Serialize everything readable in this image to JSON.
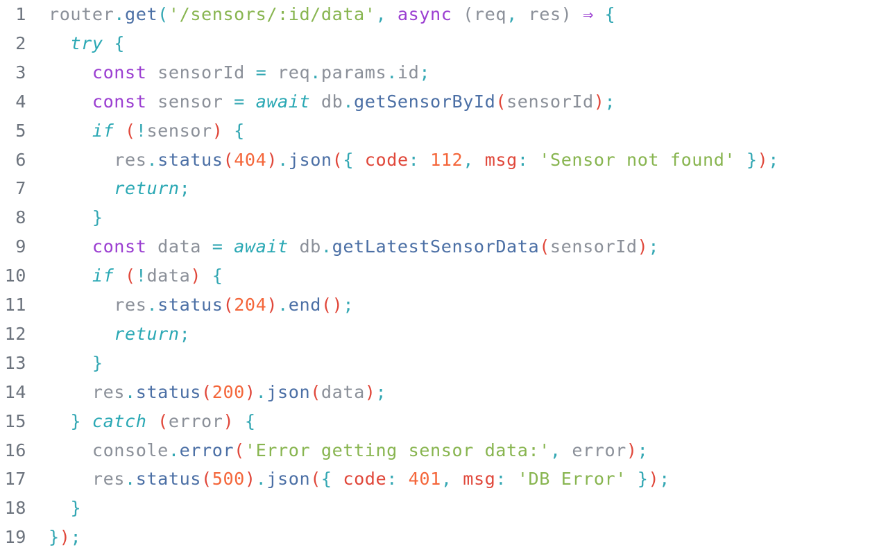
{
  "editor": {
    "colors": {
      "background": "#ffffff",
      "line_number": "#6c737d",
      "plain": "#8b9099",
      "punctuation": "#33a7b3",
      "paren": "#e0473a",
      "function": "#4b6fa5",
      "string": "#88b550",
      "keyword": "#9b3fd1",
      "control": "#2aa8b4",
      "number": "#f4663a",
      "property": "#e0473a"
    },
    "lines": [
      {
        "n": "1",
        "indent": 0,
        "tokens": [
          {
            "t": "router",
            "c": "plain"
          },
          {
            "t": ".",
            "c": "punc"
          },
          {
            "t": "get",
            "c": "func"
          },
          {
            "t": "(",
            "c": "punc"
          },
          {
            "t": "'/sensors/:id/data'",
            "c": "str"
          },
          {
            "t": ", ",
            "c": "punc"
          },
          {
            "t": "async",
            "c": "kw"
          },
          {
            "t": " ",
            "c": "plain"
          },
          {
            "t": "(",
            "c": "plain"
          },
          {
            "t": "req",
            "c": "plain"
          },
          {
            "t": ", ",
            "c": "punc"
          },
          {
            "t": "res",
            "c": "plain"
          },
          {
            "t": ")",
            "c": "plain"
          },
          {
            "t": " ",
            "c": "plain"
          },
          {
            "t": "⇒",
            "c": "kw"
          },
          {
            "t": " ",
            "c": "plain"
          },
          {
            "t": "{",
            "c": "punc"
          }
        ]
      },
      {
        "n": "2",
        "indent": 1,
        "tokens": [
          {
            "t": "try",
            "c": "ctrl"
          },
          {
            "t": " {",
            "c": "punc"
          }
        ]
      },
      {
        "n": "3",
        "indent": 2,
        "tokens": [
          {
            "t": "const",
            "c": "kw"
          },
          {
            "t": " sensorId ",
            "c": "plain"
          },
          {
            "t": "=",
            "c": "punc"
          },
          {
            "t": " req",
            "c": "plain"
          },
          {
            "t": ".",
            "c": "punc"
          },
          {
            "t": "params",
            "c": "plain"
          },
          {
            "t": ".",
            "c": "punc"
          },
          {
            "t": "id",
            "c": "plain"
          },
          {
            "t": ";",
            "c": "punc"
          }
        ]
      },
      {
        "n": "4",
        "indent": 2,
        "tokens": [
          {
            "t": "const",
            "c": "kw"
          },
          {
            "t": " sensor ",
            "c": "plain"
          },
          {
            "t": "=",
            "c": "punc"
          },
          {
            "t": " ",
            "c": "plain"
          },
          {
            "t": "await",
            "c": "ctrl"
          },
          {
            "t": " db",
            "c": "plain"
          },
          {
            "t": ".",
            "c": "punc"
          },
          {
            "t": "getSensorById",
            "c": "func"
          },
          {
            "t": "(",
            "c": "paren"
          },
          {
            "t": "sensorId",
            "c": "plain"
          },
          {
            "t": ")",
            "c": "paren"
          },
          {
            "t": ";",
            "c": "punc"
          }
        ]
      },
      {
        "n": "5",
        "indent": 2,
        "tokens": [
          {
            "t": "if",
            "c": "ctrl"
          },
          {
            "t": " ",
            "c": "plain"
          },
          {
            "t": "(",
            "c": "paren"
          },
          {
            "t": "!",
            "c": "punc"
          },
          {
            "t": "sensor",
            "c": "plain"
          },
          {
            "t": ")",
            "c": "paren"
          },
          {
            "t": " {",
            "c": "punc"
          }
        ]
      },
      {
        "n": "6",
        "indent": 3,
        "tokens": [
          {
            "t": "res",
            "c": "plain"
          },
          {
            "t": ".",
            "c": "punc"
          },
          {
            "t": "status",
            "c": "func"
          },
          {
            "t": "(",
            "c": "paren"
          },
          {
            "t": "404",
            "c": "num"
          },
          {
            "t": ")",
            "c": "paren"
          },
          {
            "t": ".",
            "c": "punc"
          },
          {
            "t": "json",
            "c": "func"
          },
          {
            "t": "(",
            "c": "paren"
          },
          {
            "t": "{ ",
            "c": "punc"
          },
          {
            "t": "code",
            "c": "prop"
          },
          {
            "t": ": ",
            "c": "punc"
          },
          {
            "t": "112",
            "c": "num"
          },
          {
            "t": ", ",
            "c": "punc"
          },
          {
            "t": "msg",
            "c": "prop"
          },
          {
            "t": ": ",
            "c": "punc"
          },
          {
            "t": "'Sensor not found'",
            "c": "str"
          },
          {
            "t": " }",
            "c": "punc"
          },
          {
            "t": ")",
            "c": "paren"
          },
          {
            "t": ";",
            "c": "punc"
          }
        ]
      },
      {
        "n": "7",
        "indent": 3,
        "tokens": [
          {
            "t": "return",
            "c": "ctrl"
          },
          {
            "t": ";",
            "c": "punc"
          }
        ]
      },
      {
        "n": "8",
        "indent": 2,
        "tokens": [
          {
            "t": "}",
            "c": "punc"
          }
        ]
      },
      {
        "n": "9",
        "indent": 2,
        "tokens": [
          {
            "t": "const",
            "c": "kw"
          },
          {
            "t": " data ",
            "c": "plain"
          },
          {
            "t": "=",
            "c": "punc"
          },
          {
            "t": " ",
            "c": "plain"
          },
          {
            "t": "await",
            "c": "ctrl"
          },
          {
            "t": " db",
            "c": "plain"
          },
          {
            "t": ".",
            "c": "punc"
          },
          {
            "t": "getLatestSensorData",
            "c": "func"
          },
          {
            "t": "(",
            "c": "paren"
          },
          {
            "t": "sensorId",
            "c": "plain"
          },
          {
            "t": ")",
            "c": "paren"
          },
          {
            "t": ";",
            "c": "punc"
          }
        ]
      },
      {
        "n": "10",
        "indent": 2,
        "tokens": [
          {
            "t": "if",
            "c": "ctrl"
          },
          {
            "t": " ",
            "c": "plain"
          },
          {
            "t": "(",
            "c": "paren"
          },
          {
            "t": "!",
            "c": "punc"
          },
          {
            "t": "data",
            "c": "plain"
          },
          {
            "t": ")",
            "c": "paren"
          },
          {
            "t": " {",
            "c": "punc"
          }
        ]
      },
      {
        "n": "11",
        "indent": 3,
        "tokens": [
          {
            "t": "res",
            "c": "plain"
          },
          {
            "t": ".",
            "c": "punc"
          },
          {
            "t": "status",
            "c": "func"
          },
          {
            "t": "(",
            "c": "paren"
          },
          {
            "t": "204",
            "c": "num"
          },
          {
            "t": ")",
            "c": "paren"
          },
          {
            "t": ".",
            "c": "punc"
          },
          {
            "t": "end",
            "c": "func"
          },
          {
            "t": "()",
            "c": "paren"
          },
          {
            "t": ";",
            "c": "punc"
          }
        ]
      },
      {
        "n": "12",
        "indent": 3,
        "tokens": [
          {
            "t": "return",
            "c": "ctrl"
          },
          {
            "t": ";",
            "c": "punc"
          }
        ]
      },
      {
        "n": "13",
        "indent": 2,
        "tokens": [
          {
            "t": "}",
            "c": "punc"
          }
        ]
      },
      {
        "n": "14",
        "indent": 2,
        "tokens": [
          {
            "t": "res",
            "c": "plain"
          },
          {
            "t": ".",
            "c": "punc"
          },
          {
            "t": "status",
            "c": "func"
          },
          {
            "t": "(",
            "c": "paren"
          },
          {
            "t": "200",
            "c": "num"
          },
          {
            "t": ")",
            "c": "paren"
          },
          {
            "t": ".",
            "c": "punc"
          },
          {
            "t": "json",
            "c": "func"
          },
          {
            "t": "(",
            "c": "paren"
          },
          {
            "t": "data",
            "c": "plain"
          },
          {
            "t": ")",
            "c": "paren"
          },
          {
            "t": ";",
            "c": "punc"
          }
        ]
      },
      {
        "n": "15",
        "indent": 1,
        "tokens": [
          {
            "t": "}",
            "c": "punc"
          },
          {
            "t": " ",
            "c": "plain"
          },
          {
            "t": "catch",
            "c": "ctrl"
          },
          {
            "t": " ",
            "c": "plain"
          },
          {
            "t": "(",
            "c": "paren"
          },
          {
            "t": "error",
            "c": "plain"
          },
          {
            "t": ")",
            "c": "paren"
          },
          {
            "t": " {",
            "c": "punc"
          }
        ]
      },
      {
        "n": "16",
        "indent": 2,
        "tokens": [
          {
            "t": "console",
            "c": "plain"
          },
          {
            "t": ".",
            "c": "punc"
          },
          {
            "t": "error",
            "c": "func"
          },
          {
            "t": "(",
            "c": "paren"
          },
          {
            "t": "'Error getting sensor data:'",
            "c": "str"
          },
          {
            "t": ", ",
            "c": "punc"
          },
          {
            "t": "error",
            "c": "plain"
          },
          {
            "t": ")",
            "c": "paren"
          },
          {
            "t": ";",
            "c": "punc"
          }
        ]
      },
      {
        "n": "17",
        "indent": 2,
        "tokens": [
          {
            "t": "res",
            "c": "plain"
          },
          {
            "t": ".",
            "c": "punc"
          },
          {
            "t": "status",
            "c": "func"
          },
          {
            "t": "(",
            "c": "paren"
          },
          {
            "t": "500",
            "c": "num"
          },
          {
            "t": ")",
            "c": "paren"
          },
          {
            "t": ".",
            "c": "punc"
          },
          {
            "t": "json",
            "c": "func"
          },
          {
            "t": "(",
            "c": "paren"
          },
          {
            "t": "{ ",
            "c": "punc"
          },
          {
            "t": "code",
            "c": "prop"
          },
          {
            "t": ": ",
            "c": "punc"
          },
          {
            "t": "401",
            "c": "num"
          },
          {
            "t": ", ",
            "c": "punc"
          },
          {
            "t": "msg",
            "c": "prop"
          },
          {
            "t": ": ",
            "c": "punc"
          },
          {
            "t": "'DB Error'",
            "c": "str"
          },
          {
            "t": " }",
            "c": "punc"
          },
          {
            "t": ")",
            "c": "paren"
          },
          {
            "t": ";",
            "c": "punc"
          }
        ]
      },
      {
        "n": "18",
        "indent": 1,
        "tokens": [
          {
            "t": "}",
            "c": "punc"
          }
        ]
      },
      {
        "n": "19",
        "indent": 0,
        "tokens": [
          {
            "t": "}",
            "c": "punc"
          },
          {
            "t": ")",
            "c": "paren"
          },
          {
            "t": ";",
            "c": "punc"
          }
        ]
      }
    ]
  }
}
